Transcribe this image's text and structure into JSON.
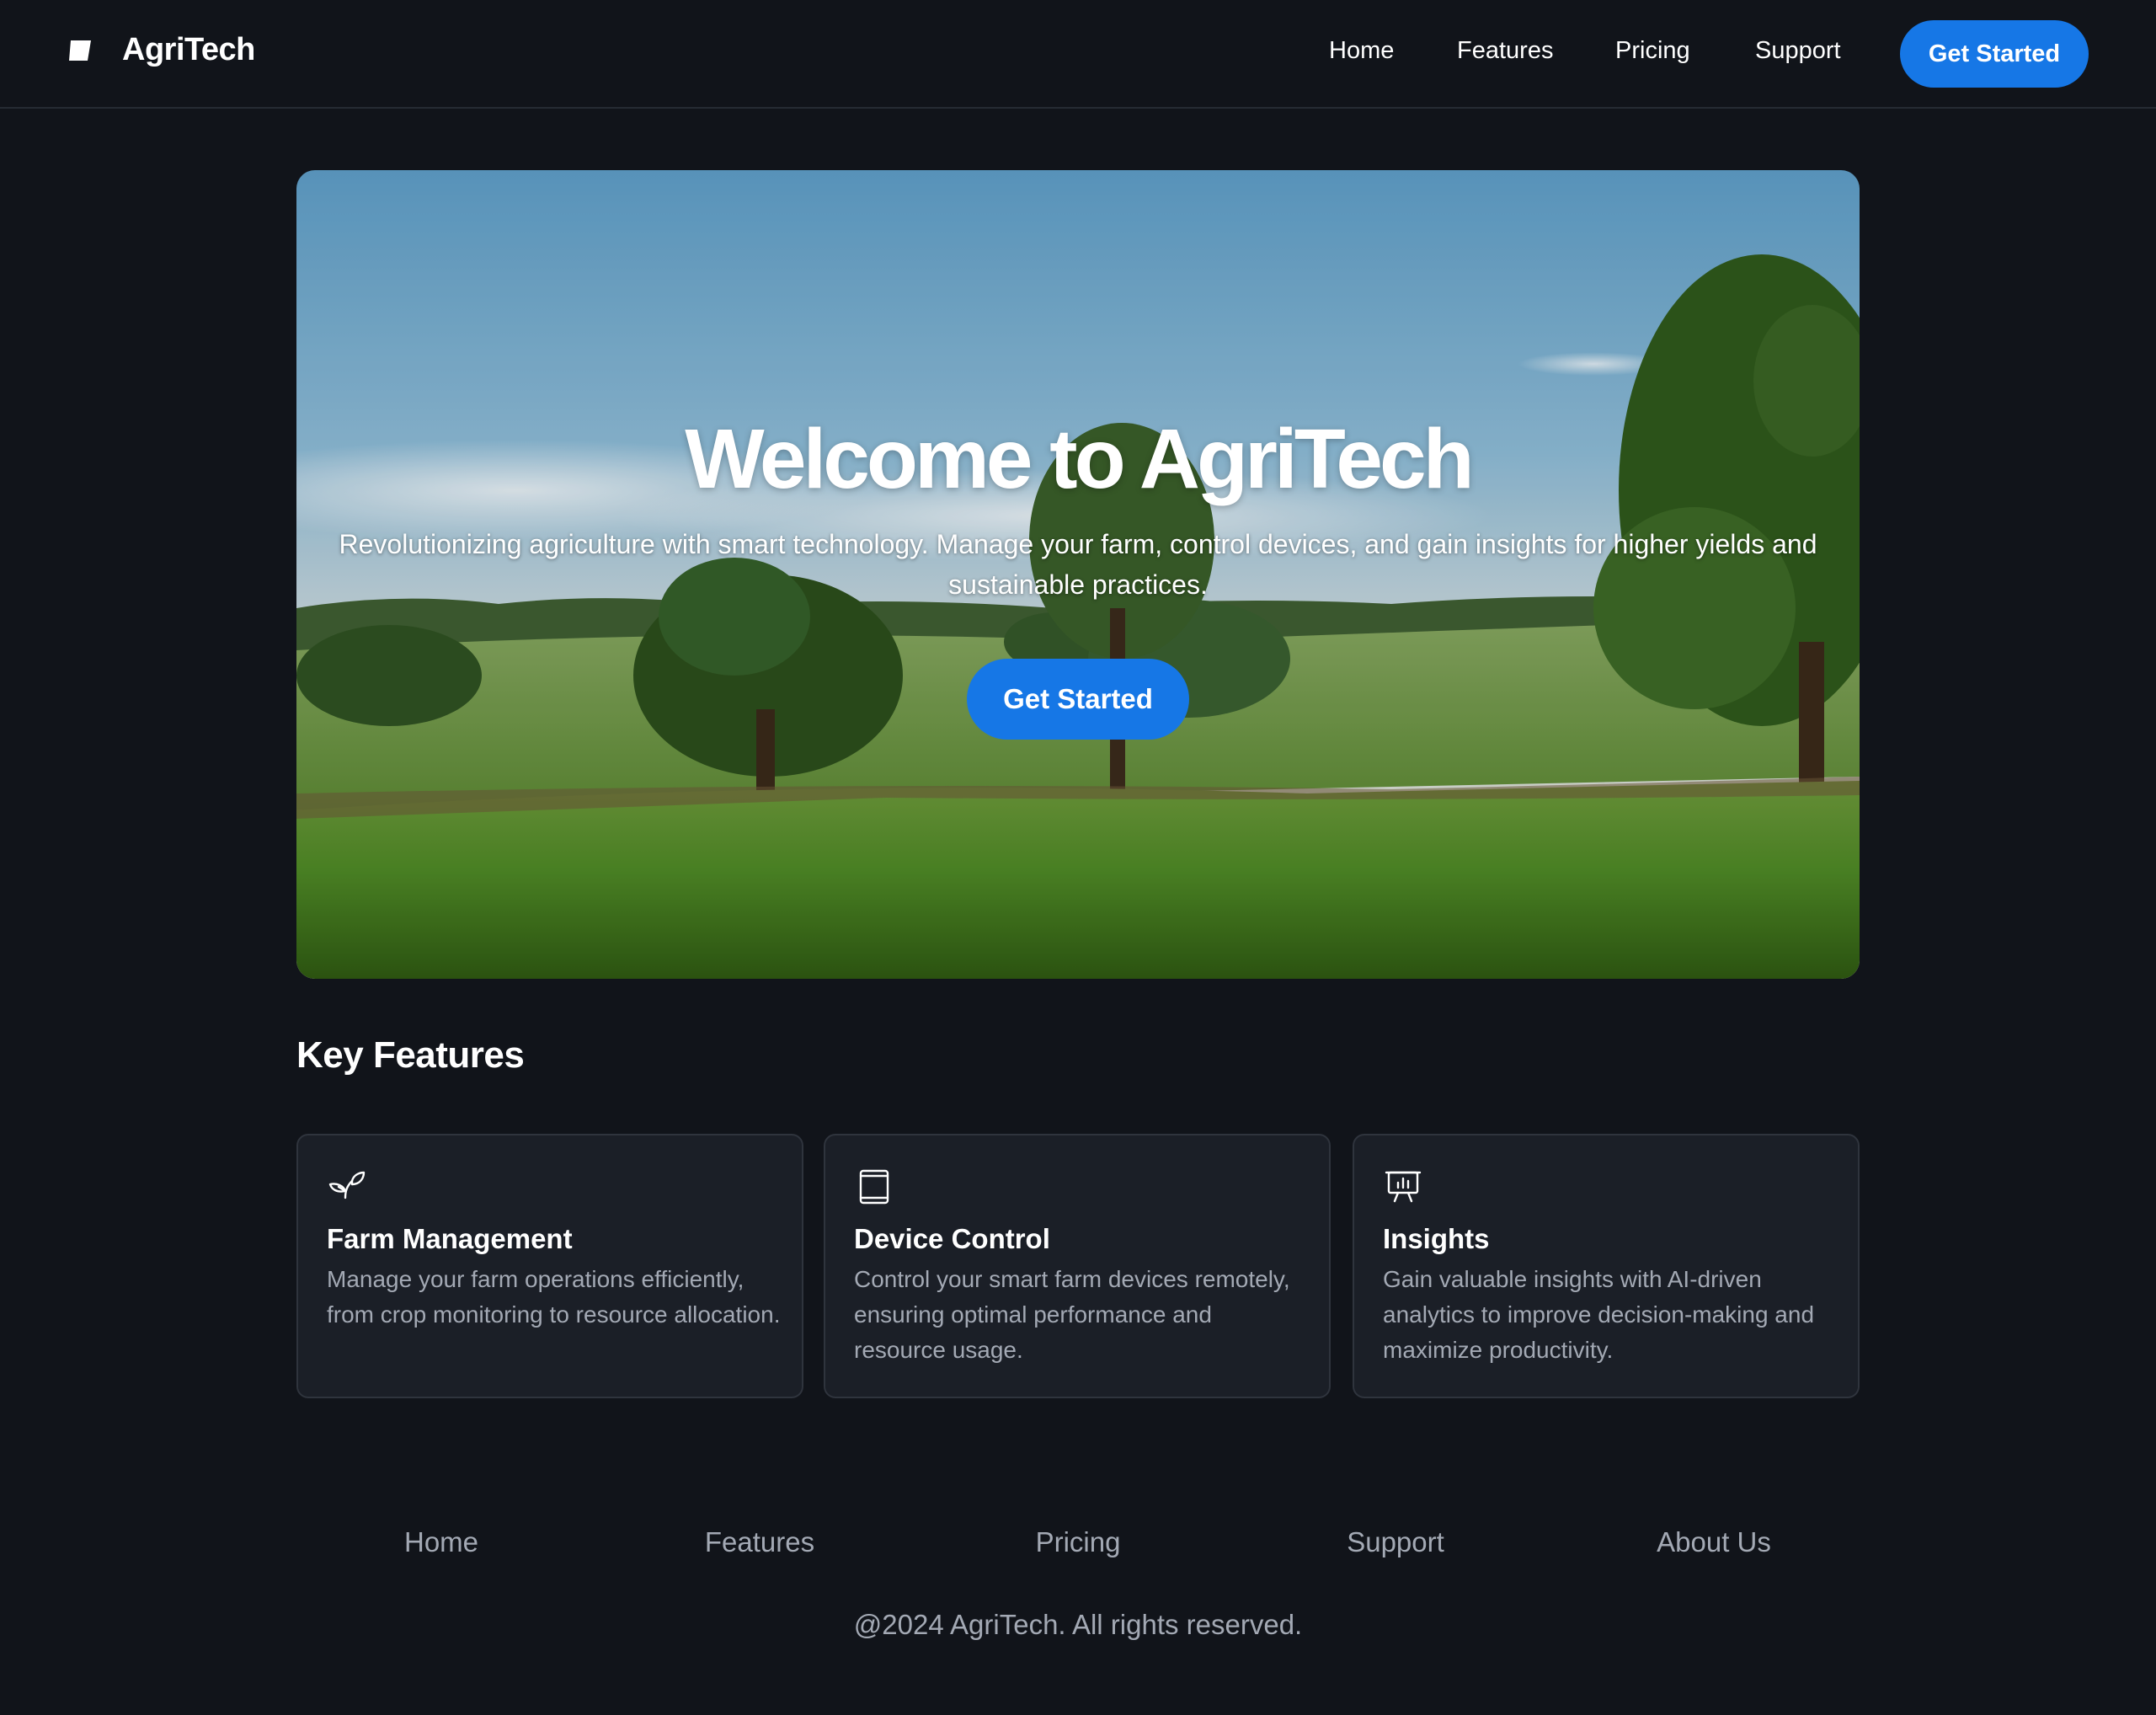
{
  "header": {
    "brand_name": "AgriTech",
    "nav": [
      "Home",
      "Features",
      "Pricing",
      "Support"
    ],
    "cta_label": "Get Started"
  },
  "hero": {
    "title": "Welcome to AgriTech",
    "subtitle": "Revolutionizing agriculture with smart technology. Manage your farm, control devices, and gain insights for higher yields and sustainable practices.",
    "cta_label": "Get Started"
  },
  "features": {
    "title": "Key Features",
    "cards": [
      {
        "icon": "sprout-icon",
        "title": "Farm Management",
        "desc": "Manage your farm operations efficiently, from crop monitoring to resource allocation."
      },
      {
        "icon": "tablet-icon",
        "title": "Device Control",
        "desc": "Control your smart farm devices remotely, ensuring optimal performance and resource usage."
      },
      {
        "icon": "presentation-chart-icon",
        "title": "Insights",
        "desc": "Gain valuable insights with AI-driven analytics to improve decision-making and maximize productivity."
      }
    ]
  },
  "footer": {
    "links": [
      "Home",
      "Features",
      "Pricing",
      "Support",
      "About Us"
    ],
    "copyright": "@2024 AgriTech. All rights reserved."
  },
  "colors": {
    "background": "#11141a",
    "accent": "#1677e6",
    "card": "#1b1f27",
    "muted_text": "#a3a9b4"
  }
}
